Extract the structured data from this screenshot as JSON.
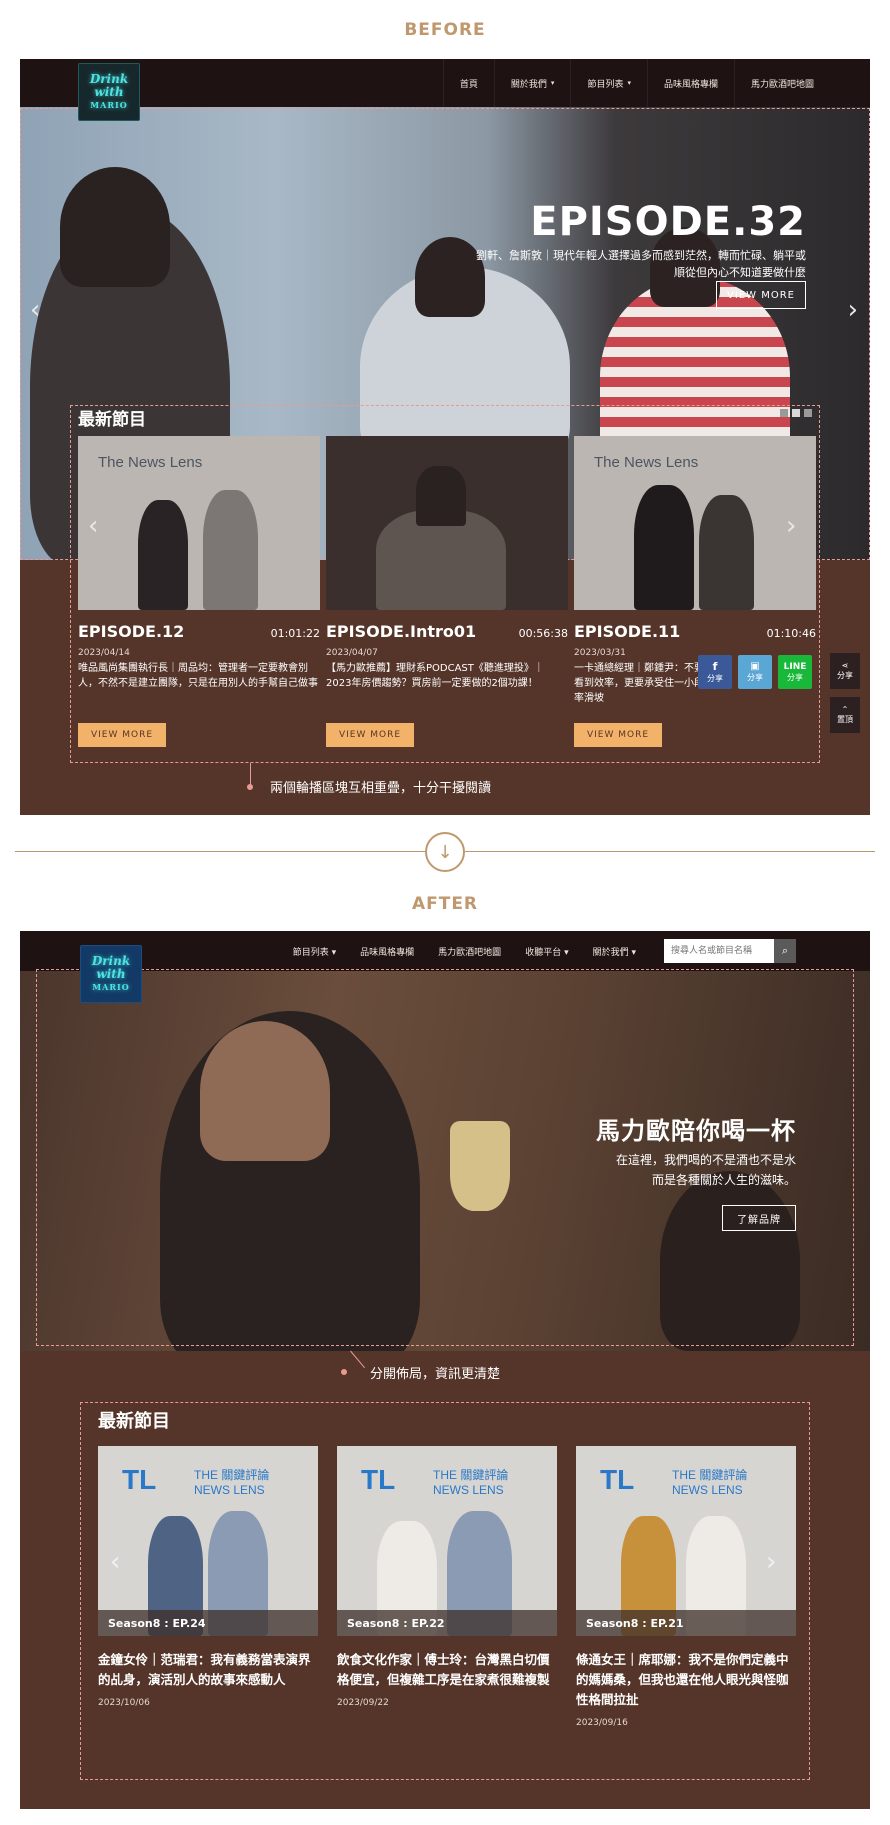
{
  "labels": {
    "before": "BEFORE",
    "after": "AFTER"
  },
  "before": {
    "logo": {
      "line1": "Drink",
      "line2": "with",
      "line3": "MARIO"
    },
    "nav": [
      {
        "label": "首頁",
        "caret": false
      },
      {
        "label": "關於我們",
        "caret": true
      },
      {
        "label": "節目列表",
        "caret": true
      },
      {
        "label": "品味風格專欄",
        "caret": false
      },
      {
        "label": "馬力歐酒吧地圖",
        "caret": false
      }
    ],
    "hero": {
      "title": "EPISODE.32",
      "subtitle": "劉軒、詹斯敦｜現代年輕人選擇過多而感到茫然，轉而忙碌、躺平或順從但內心不知道要做什麼",
      "button": "VIEW MORE"
    },
    "latest_title": "最新節目",
    "episodes": [
      {
        "name": "EPISODE.12",
        "duration": "01:01:22",
        "date": "2023/04/14",
        "desc": "唯品風尚集團執行長｜周品均：管理者一定要教會別人，不然不是建立團隊，只是在用別人的手幫自己做事",
        "button": "VIEW MORE"
      },
      {
        "name": "EPISODE.Intro01",
        "duration": "00:56:38",
        "date": "2023/04/07",
        "desc": "【馬力歐推薦】理財系PODCAST《聽進理投》｜2023年房價趨勢？買房前一定要做的2個功課！",
        "button": "VIEW MORE"
      },
      {
        "name": "EPISODE.11",
        "duration": "01:10:46",
        "date": "2023/03/31",
        "desc": "一卡通總經理｜鄭鍾尹：不要只看到效率，更要承受住一小段效率滑坡",
        "button": "VIEW MORE"
      }
    ],
    "share": [
      {
        "label": "分享",
        "icon": "facebook-icon",
        "color": "#3b5998"
      },
      {
        "label": "分享",
        "icon": "share-square-icon",
        "color": "#5aa7d6"
      },
      {
        "label": "分享",
        "icon": "line-icon",
        "top": "LINE",
        "color": "#19b83a"
      }
    ],
    "side": {
      "share": "分享",
      "top": "置頂"
    },
    "callout": "兩個輪播區塊互相重疊，十分干擾閱讀"
  },
  "after": {
    "logo": {
      "line1": "Drink",
      "line2": "with",
      "line3": "MARIO"
    },
    "nav": [
      {
        "label": "節目列表",
        "caret": true
      },
      {
        "label": "品味風格專欄",
        "caret": false
      },
      {
        "label": "馬力歐酒吧地圖",
        "caret": false
      },
      {
        "label": "收聽平台",
        "caret": true
      },
      {
        "label": "關於我們",
        "caret": true
      }
    ],
    "search_placeholder": "搜尋人名或節目名稱",
    "hero": {
      "title": "馬力歐陪你喝一杯",
      "line1": "在這裡，我們喝的不是酒也不是水",
      "line2": "而是各種關於人生的滋味。",
      "button": "了解品牌"
    },
    "callout": "分開佈局，資訊更清楚",
    "latest_title": "最新節目",
    "cards": [
      {
        "season": "Season8 : EP.24",
        "title": "金鐘女伶｜范瑞君：我有義務當表演界的乩身，演活別人的故事來感動人",
        "date": "2023/10/06"
      },
      {
        "season": "Season8 : EP.22",
        "title": "飲食文化作家｜傅士玲：台灣黑白切價格便宜，但複雜工序是在家煮很難複製",
        "date": "2023/09/22"
      },
      {
        "season": "Season8 : EP.21",
        "title": "條通女王｜席耶娜：我不是你們定義中的媽媽桑，但我也還在他人眼光與怪咖性格間拉扯",
        "date": "2023/09/16"
      }
    ]
  },
  "colors": {
    "brown": "#553429",
    "accent": "#c0986e",
    "dash": "#e99a92",
    "orange_btn": "#f2b26a"
  }
}
